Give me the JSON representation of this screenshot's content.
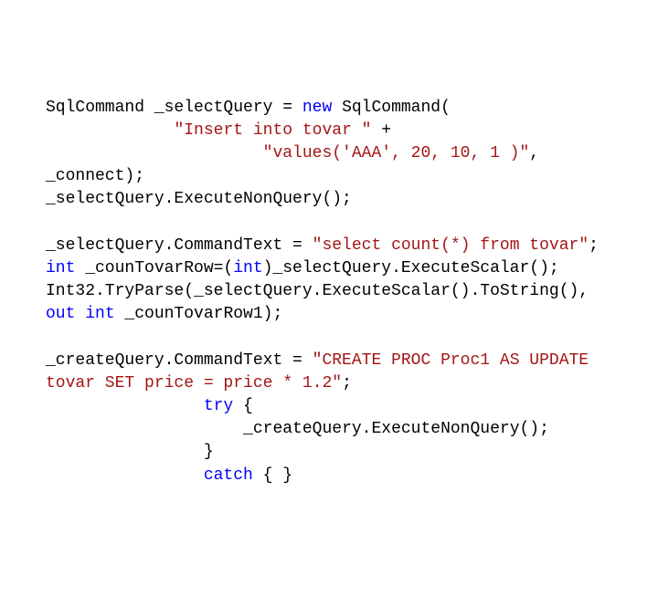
{
  "code": {
    "l1": {
      "t1": "SqlCommand _selectQuery = ",
      "kw1": "new",
      "t2": " SqlCommand("
    },
    "l2": {
      "pad": "             ",
      "str": "\"Insert into tovar \"",
      "t": " +"
    },
    "l3": {
      "pad": "                      ",
      "str": "\"values('AAA', 20, 10, 1 )\"",
      "t": ","
    },
    "l4": {
      "t": "_connect);"
    },
    "l5": {
      "t": "_selectQuery.ExecuteNonQuery();"
    },
    "l6": {
      "t": ""
    },
    "l7": {
      "t1": "_selectQuery.CommandText = ",
      "str": "\"select count(*) from tovar\"",
      "t2": ";"
    },
    "l8": {
      "kw1": "int",
      "t1": " _counTovarRow=(",
      "kw2": "int",
      "t2": ")_selectQuery.ExecuteScalar();"
    },
    "l9": {
      "t": "Int32.TryParse(_selectQuery.ExecuteScalar().ToString(),"
    },
    "l10": {
      "kw1": "out",
      "t1": " ",
      "kw2": "int",
      "t2": " _counTovarRow1);"
    },
    "l11": {
      "t": ""
    },
    "l12": {
      "t1": "_createQuery.CommandText = ",
      "str1": "\"CREATE PROC Proc1 AS UPDATE "
    },
    "l13": {
      "str2": "tovar SET price = price * 1.2\"",
      "t2": ";"
    },
    "l14": {
      "pad": "                ",
      "kw": "try",
      "t": " {"
    },
    "l15": {
      "pad": "                    ",
      "t": "_createQuery.ExecuteNonQuery();"
    },
    "l16": {
      "pad": "                ",
      "t": "}"
    },
    "l17": {
      "pad": "                ",
      "kw": "catch",
      "t": " { }"
    }
  }
}
